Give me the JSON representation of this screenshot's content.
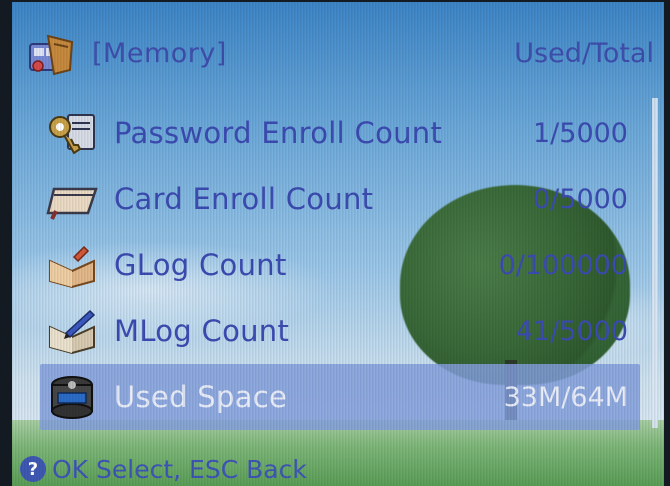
{
  "header": {
    "title": "[Memory]",
    "right_label": "Used/Total",
    "icon": "memory-icon"
  },
  "list": {
    "items": [
      {
        "icon": "key-icon",
        "label": "Password Enroll Count",
        "value": "1/5000",
        "selected": false
      },
      {
        "icon": "card-icon",
        "label": "Card Enroll Count",
        "value": "0/5000",
        "selected": false
      },
      {
        "icon": "glog-book-icon",
        "label": "GLog Count",
        "value": "0/100000",
        "selected": false
      },
      {
        "icon": "mlog-book-icon",
        "label": "MLog Count",
        "value": "41/5000",
        "selected": false
      },
      {
        "icon": "storage-icon",
        "label": "Used Space",
        "value": "33M/64M",
        "selected": true
      }
    ]
  },
  "footer": {
    "icon_glyph": "?",
    "hint": "OK Select, ESC Back"
  },
  "colors": {
    "text": "#3c4cb2",
    "selection": "#84a0de"
  }
}
